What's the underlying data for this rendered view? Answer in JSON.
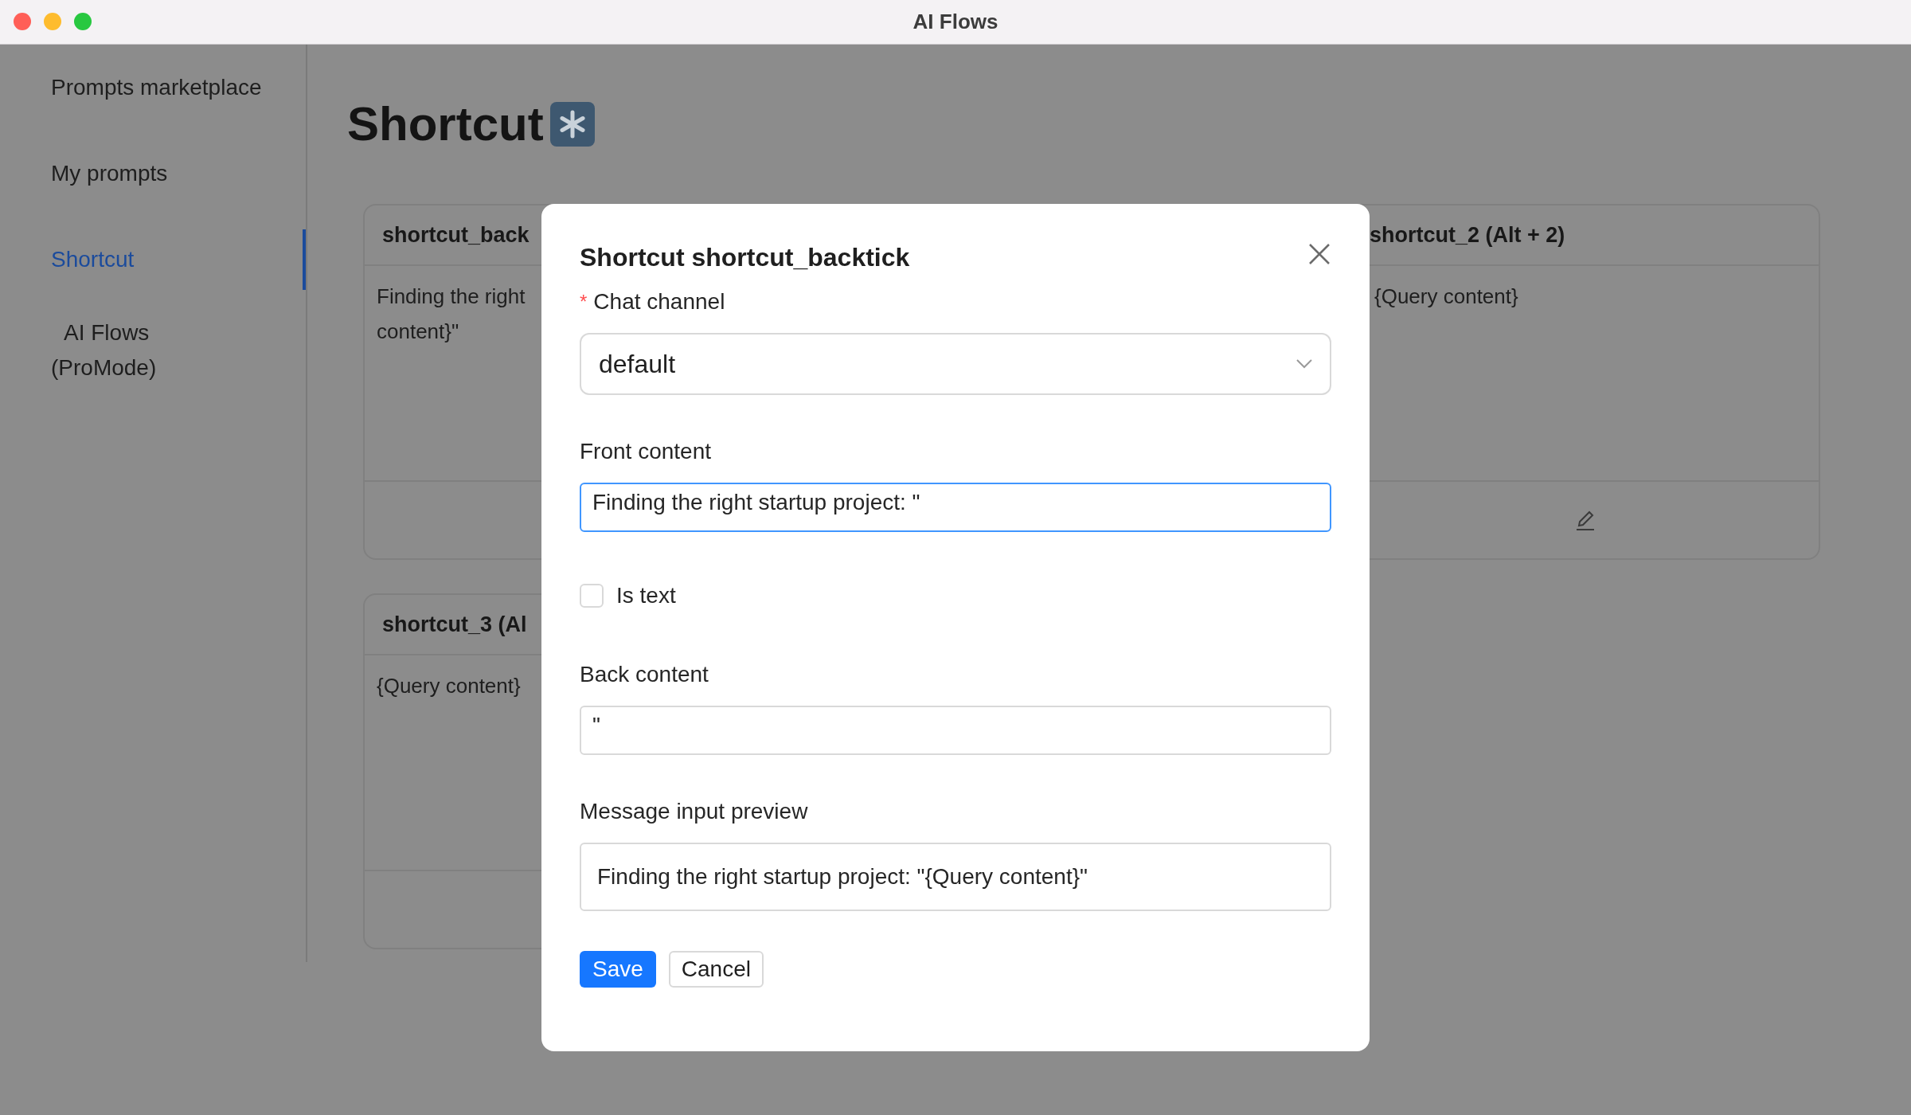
{
  "window": {
    "title": "AI Flows"
  },
  "sidebar": {
    "items": [
      {
        "label": "Prompts marketplace",
        "selected": false
      },
      {
        "label": "My prompts",
        "selected": false
      },
      {
        "label": "Shortcut",
        "selected": true
      },
      {
        "label": "AI Flows (ProMode)",
        "selected": false
      }
    ]
  },
  "page": {
    "title": "Shortcut"
  },
  "cards": [
    {
      "title": "shortcut_back",
      "body": [
        "Finding the right",
        "content}\""
      ]
    },
    {
      "title": "shortcut_2 (Alt + 2)",
      "body": [
        "{Query content}"
      ],
      "edit_icon": true
    },
    {
      "title": "shortcut_3 (Al",
      "body": [
        "{Query content}"
      ]
    }
  ],
  "dialog": {
    "title": "Shortcut shortcut_backtick",
    "fields": [
      {
        "kind": "select",
        "label": "Chat channel",
        "required_mark": "*",
        "value": "default"
      },
      {
        "kind": "input",
        "label": "Front content",
        "value": "Finding the right startup project: \"",
        "focused": true
      },
      {
        "kind": "checkbox",
        "label": "Is text",
        "checked": false
      },
      {
        "kind": "input",
        "label": "Back content",
        "value": "\"",
        "focused": false
      },
      {
        "kind": "preview",
        "label": "Message input preview",
        "value": "Finding the right startup project: \"{Query content}\""
      }
    ],
    "buttons": [
      {
        "label": "Save",
        "kind": "primary"
      },
      {
        "label": "Cancel",
        "kind": "default"
      }
    ]
  }
}
